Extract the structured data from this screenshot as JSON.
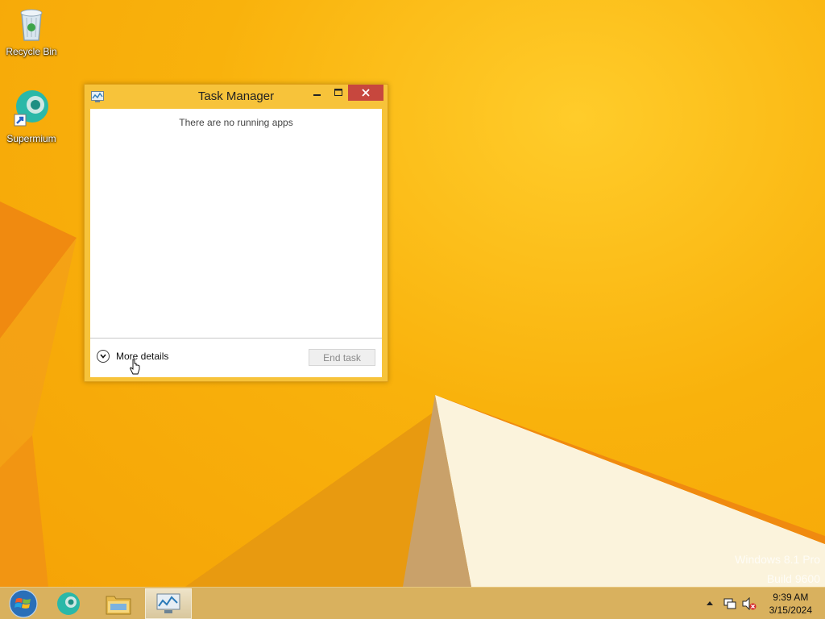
{
  "desktop": {
    "icons": [
      {
        "label": "Recycle Bin",
        "icon": "recycle-bin-icon"
      },
      {
        "label": "Supermium",
        "icon": "supermium-browser-icon"
      }
    ],
    "watermark": {
      "line1": "Windows 8.1 Pro",
      "line2": "Build 9600"
    }
  },
  "window": {
    "title": "Task Manager",
    "app_icon": "task-manager-icon",
    "empty_message": "There are no running apps",
    "more_details_label": "More details",
    "end_task_label": "End task",
    "buttons": {
      "minimize": "minimize-icon",
      "maximize": "maximize-icon",
      "close": "close-icon"
    }
  },
  "taskbar": {
    "items": [
      {
        "name": "start-button",
        "icon": "windows-start-orb-icon"
      },
      {
        "name": "supermium",
        "icon": "supermium-browser-icon"
      },
      {
        "name": "file-explorer",
        "icon": "folder-icon"
      },
      {
        "name": "task-manager",
        "icon": "task-manager-icon",
        "active": true
      }
    ],
    "tray": {
      "icons": [
        "show-hidden-icons-chevron-icon",
        "network-icon",
        "volume-muted-icon"
      ],
      "time": "9:39 AM",
      "date": "3/15/2024"
    }
  },
  "colors": {
    "desktop_accent": "#f9b20c",
    "window_frame": "#f7c33a",
    "close_button": "#c7473e",
    "taskbar": "#d9b15e"
  }
}
